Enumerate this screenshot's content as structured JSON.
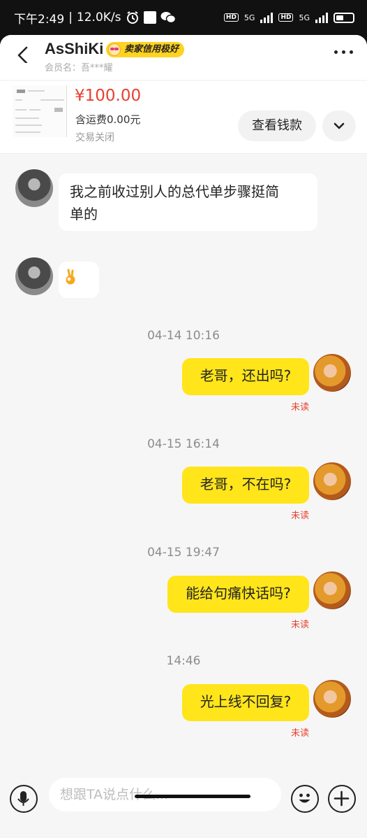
{
  "status_bar": {
    "time": "下午2:49",
    "speed": "12.0K/s",
    "hd1": "HD",
    "net1": "5G",
    "hd2": "HD",
    "net2": "5G"
  },
  "header": {
    "title": "AsShiKi",
    "badge": "卖家信用极好",
    "subtitle": "会员名：吾***耀"
  },
  "product": {
    "price": "¥100.00",
    "shipping": "含运费0.00元",
    "status": "交易关闭",
    "view_button": "查看钱款"
  },
  "messages": [
    {
      "from": "other",
      "text": "我之前收过别人的总代单步骤挺简单的"
    },
    {
      "from": "other",
      "text": "👌",
      "icon": "ok-hand-icon"
    },
    {
      "time": "04-14 10:16"
    },
    {
      "from": "self",
      "text": "老哥，还出吗?",
      "status": "未读"
    },
    {
      "time": "04-15 16:14"
    },
    {
      "from": "self",
      "text": "老哥，不在吗?",
      "status": "未读"
    },
    {
      "time": "04-15 19:47"
    },
    {
      "from": "self",
      "text": "能给句痛快话吗?",
      "status": "未读"
    },
    {
      "time": "14:46"
    },
    {
      "from": "self",
      "text": "光上线不回复?",
      "status": "未读"
    }
  ],
  "chat_lines": {
    "line1": "我之前收过别人的总代单步骤挺简",
    "line2": "单的"
  },
  "input": {
    "placeholder": "想跟TA说点什么..."
  },
  "colors": {
    "accent_yellow": "#ffe51a",
    "price_red": "#e8402f"
  }
}
